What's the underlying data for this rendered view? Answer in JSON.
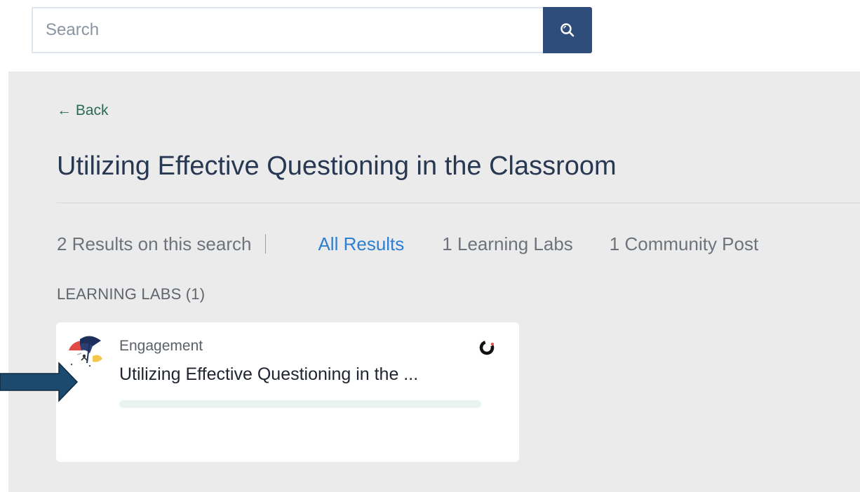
{
  "search": {
    "placeholder": "Search",
    "value": "",
    "button_icon": "search-icon"
  },
  "nav": {
    "back_label": "← Back"
  },
  "page": {
    "title": "Utilizing Effective Questioning in the Classroom"
  },
  "results": {
    "count_label": "2 Results on this search",
    "tabs": [
      {
        "label": "All Results",
        "active": true
      },
      {
        "label": "1 Learning Labs",
        "active": false
      },
      {
        "label": "1 Community Post",
        "active": false
      }
    ],
    "active_color": "#2d7fd1"
  },
  "sections": [
    {
      "heading": "LEARNING LABS (1)",
      "cards": [
        {
          "category": "Engagement",
          "title": "Utilizing Effective Questioning in the ...",
          "thumbnail_icon": "umbrella-illustration-icon",
          "status_icon": "progress-ring-icon",
          "progress": 0
        }
      ]
    }
  ],
  "annotation": {
    "arrow_icon": "callout-arrow-icon",
    "arrow_color": "#1c4a6e"
  },
  "colors": {
    "search_button": "#2f4d7a",
    "panel_background": "#ebebeb",
    "title_text": "#283852",
    "back_link": "#2b6a57"
  }
}
